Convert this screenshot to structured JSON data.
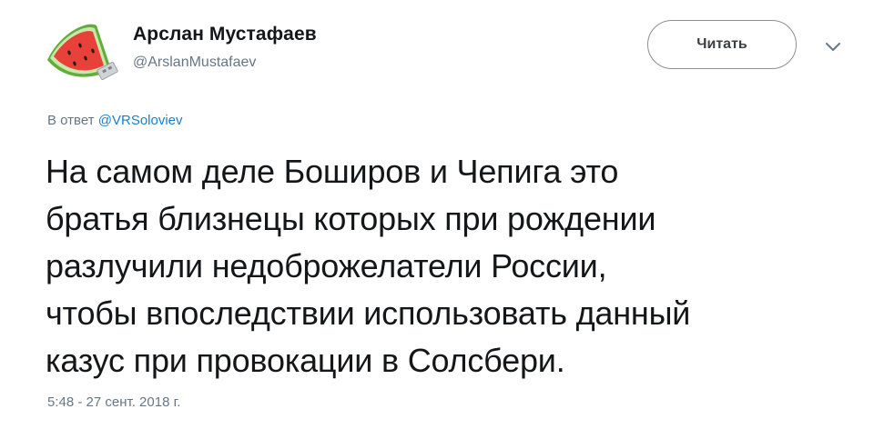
{
  "author": {
    "name": "Арслан Мустафаев",
    "handle": "@ArslanMustafaev",
    "avatar_icon": "watermelon-usb-icon"
  },
  "actions": {
    "follow_label": "Читать",
    "more_icon": "chevron-down-icon"
  },
  "reply_context": {
    "prefix": "В ответ",
    "mention": "@VRSoloviev"
  },
  "tweet": {
    "text_lines": [
      "На самом деле Боширов и Чепига это",
      "братья близнецы которых при рождении",
      "разлучили недоброжелатели России,",
      "чтобы впоследствии использовать данный",
      "казус при провокации в Солсбери."
    ],
    "timestamp": "5:48 - 27 сент. 2018 г."
  },
  "colors": {
    "text": "#14171a",
    "secondary": "#657786",
    "link": "#1b7fcb",
    "border": "#8a8f94",
    "watermelon_flesh": "#e8413a",
    "watermelon_rind": "#5fae3a"
  }
}
